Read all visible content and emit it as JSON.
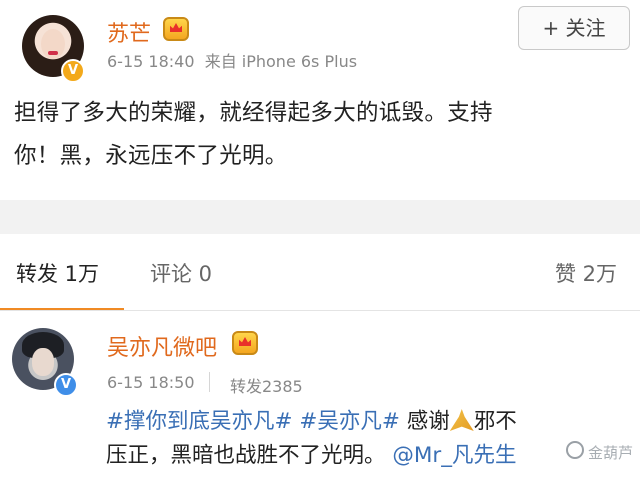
{
  "post": {
    "author": "苏芒",
    "timestamp": "6-15 18:40",
    "source": "来自 iPhone 6s Plus",
    "verified_badge": "V",
    "follow_label": "+ 关注",
    "content_line1": "担得了多大的荣耀，就经得起多大的诋毁。支持",
    "content_line2": "你！黑，永远压不了光明。"
  },
  "tabs": {
    "repost": "转发 1万",
    "comment": "评论 0",
    "like": "赞 2万"
  },
  "repost_item": {
    "author": "吴亦凡微吧",
    "timestamp": "6-15 18:50",
    "repost_count": "转发2385",
    "verified_badge": "V",
    "text_tag1": "#撑你到底吴亦凡#",
    "text_tag2": "#吴亦凡#",
    "text_thanks": " 感谢",
    "emoji": "folded-hands-icon",
    "text_after_emoji": "邪不",
    "text_line2": "压正，黑暗也战胜不了光明。",
    "mention": "@Mr_凡先生"
  },
  "watermark": "金葫芦",
  "colors": {
    "name_orange": "#e0691d",
    "link_blue": "#3a6fb5",
    "tab_underline": "#f08a24",
    "badge_gold": "#f3a91b",
    "badge_blue": "#3f8ee8"
  }
}
